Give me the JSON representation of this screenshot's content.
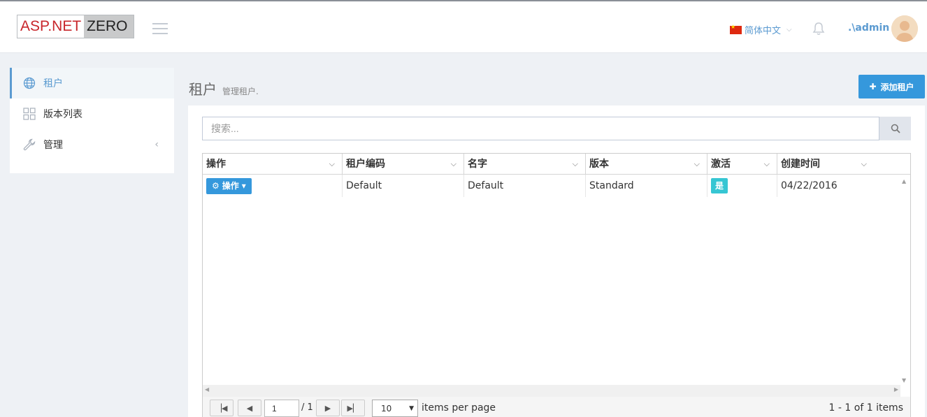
{
  "header": {
    "logo_left": "ASP.NET",
    "logo_right": "ZERO",
    "language": "简体中文",
    "username": ".\\admin"
  },
  "sidebar": {
    "items": [
      {
        "label": "租户",
        "icon": "globe-icon",
        "active": true
      },
      {
        "label": "版本列表",
        "icon": "grid-icon",
        "active": false
      },
      {
        "label": "管理",
        "icon": "wrench-icon",
        "active": false
      }
    ]
  },
  "page": {
    "title": "租户",
    "subtitle": "管理租户.",
    "add_button": "添加租户"
  },
  "search": {
    "placeholder": "搜索..."
  },
  "table": {
    "columns": [
      "操作",
      "租户编码",
      "名字",
      "版本",
      "激活",
      "创建时间"
    ],
    "rows": [
      {
        "action": "操作",
        "tenancy_name": "Default",
        "name": "Default",
        "edition": "Standard",
        "active": "是",
        "creation_time": "04/22/2016"
      }
    ]
  },
  "pager": {
    "current_page": "1",
    "total_pages": "/ 1",
    "page_size": "10",
    "items_per_page_label": "items per page",
    "info": "1 - 1 of 1 items"
  },
  "colors": {
    "primary": "#3598dc",
    "active_badge": "#36c6d3",
    "sidebar_active": "#5b9bd1",
    "background": "#eef1f5"
  }
}
